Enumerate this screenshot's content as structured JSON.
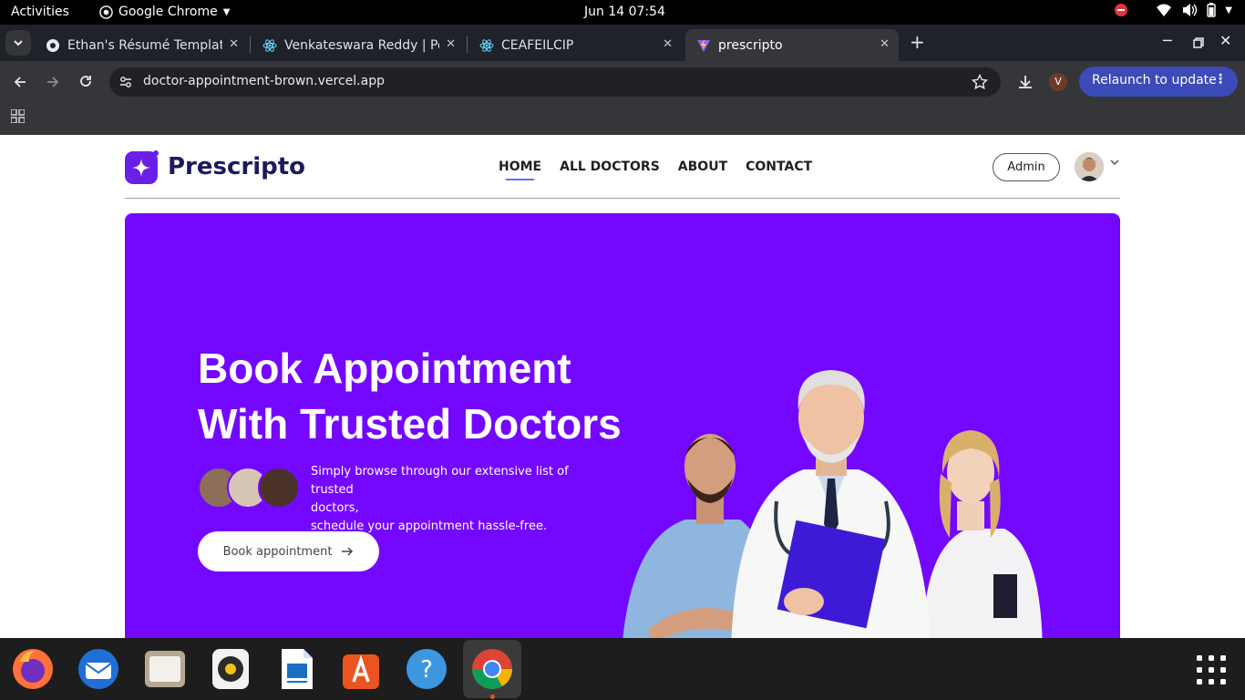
{
  "system_bar": {
    "activities": "Activities",
    "app_name": "Google Chrome",
    "clock": "Jun 14  07:54"
  },
  "browser": {
    "tabs": [
      {
        "title": "Ethan's Résumé Templat",
        "icon": "resume-favicon-icon"
      },
      {
        "title": "Venkateswara Reddy | Po",
        "icon": "react-icon"
      },
      {
        "title": "CEAFEILCIP",
        "icon": "react-icon"
      },
      {
        "title": "prescripto",
        "icon": "vite-icon",
        "active": true
      }
    ],
    "url": "doctor-appointment-brown.vercel.app",
    "profile_initial": "V",
    "relaunch_label": "Relaunch to update"
  },
  "site": {
    "brand": "Prescripto",
    "nav": [
      "HOME",
      "ALL DOCTORS",
      "ABOUT",
      "CONTACT"
    ],
    "active_nav": "HOME",
    "admin_label": "Admin",
    "accent_color": "#7407ff",
    "hero": {
      "title_line1": "Book Appointment",
      "title_line2": "With Trusted Doctors",
      "desc_line1": "Simply browse through our extensive list of trusted",
      "desc_line2": "doctors,",
      "desc_line3": "schedule your appointment hassle-free.",
      "cta": "Book appointment"
    }
  },
  "dock": {
    "apps": [
      "Firefox",
      "Thunderbird",
      "Files",
      "Rhythmbox",
      "LibreOffice Writer",
      "App Center",
      "Help",
      "Google Chrome"
    ]
  }
}
